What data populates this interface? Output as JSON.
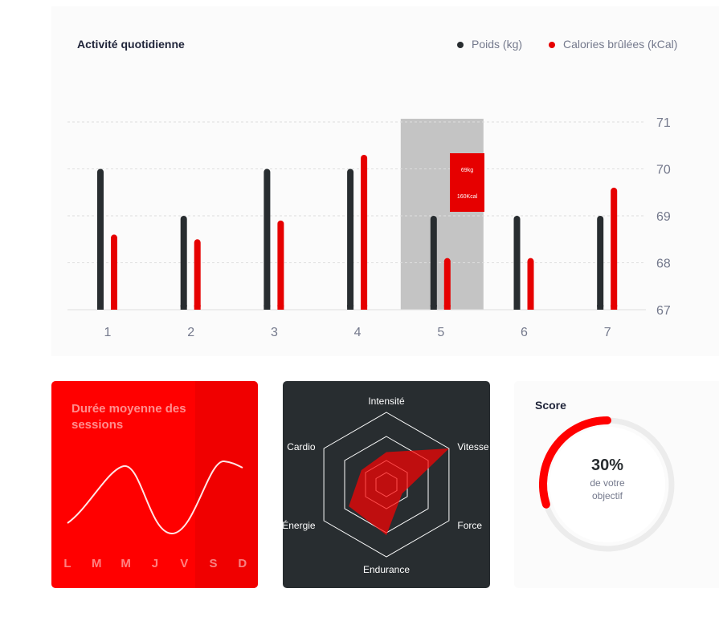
{
  "activity": {
    "title": "Activité quotidienne",
    "legend": [
      {
        "label": "Poids (kg)",
        "color": "#282d30"
      },
      {
        "label": "Calories brûlées (kCal)",
        "color": "#e60000"
      }
    ],
    "tooltip": {
      "weight": "69kg",
      "calories": "160Kcal"
    },
    "highlight_day": "5"
  },
  "sessions": {
    "title": "Durée moyenne des sessions",
    "days": [
      "L",
      "M",
      "M",
      "J",
      "V",
      "S",
      "D"
    ]
  },
  "radar": {
    "labels": [
      "Intensité",
      "Vitesse",
      "Force",
      "Endurance",
      "Énergie",
      "Cardio"
    ]
  },
  "score": {
    "title": "Score",
    "value": "30%",
    "line1": "de votre",
    "line2": "objectif",
    "fraction": 0.3
  },
  "chart_data": [
    {
      "type": "bar",
      "title": "Activité quotidienne",
      "categories": [
        "1",
        "2",
        "3",
        "4",
        "5",
        "6",
        "7"
      ],
      "series": [
        {
          "name": "Poids (kg)",
          "values": [
            70,
            69,
            70,
            70,
            69,
            69,
            69
          ]
        },
        {
          "name": "Calories brûlées (kCal)",
          "values": [
            68.6,
            68.5,
            68.9,
            70.3,
            68.1,
            68.1,
            69.6
          ]
        }
      ],
      "ylim": [
        67,
        71
      ],
      "yticks": [
        67,
        68,
        69,
        70,
        71
      ],
      "grid": true,
      "legend": "top-right"
    },
    {
      "type": "line",
      "title": "Durée moyenne des sessions",
      "categories": [
        "L",
        "M",
        "M",
        "J",
        "V",
        "S",
        "D"
      ],
      "values": [
        30,
        23,
        45,
        50,
        0,
        0,
        60
      ]
    },
    {
      "type": "radar",
      "categories": [
        "Intensité",
        "Vitesse",
        "Force",
        "Endurance",
        "Énergie",
        "Cardio"
      ],
      "values": [
        90,
        200,
        50,
        140,
        120,
        80
      ],
      "max": 200
    },
    {
      "type": "pie",
      "title": "Score",
      "values": [
        30,
        70
      ]
    }
  ]
}
